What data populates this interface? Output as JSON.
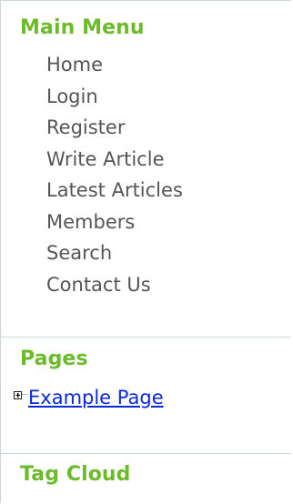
{
  "sections": {
    "main_menu": {
      "title": "Main Menu",
      "items": [
        {
          "label": "Home"
        },
        {
          "label": "Login"
        },
        {
          "label": "Register"
        },
        {
          "label": "Write Article"
        },
        {
          "label": "Latest Articles"
        },
        {
          "label": "Members"
        },
        {
          "label": "Search"
        },
        {
          "label": "Contact Us"
        }
      ]
    },
    "pages": {
      "title": "Pages",
      "tree": [
        {
          "label": "Example Page",
          "expand_icon": "plus-box-icon"
        }
      ]
    },
    "tag_cloud": {
      "title": "Tag Cloud"
    }
  },
  "colors": {
    "heading": "#6cbb2a",
    "menu_text": "#555555",
    "link": "#0b2ad6",
    "border": "#c9d6df"
  }
}
